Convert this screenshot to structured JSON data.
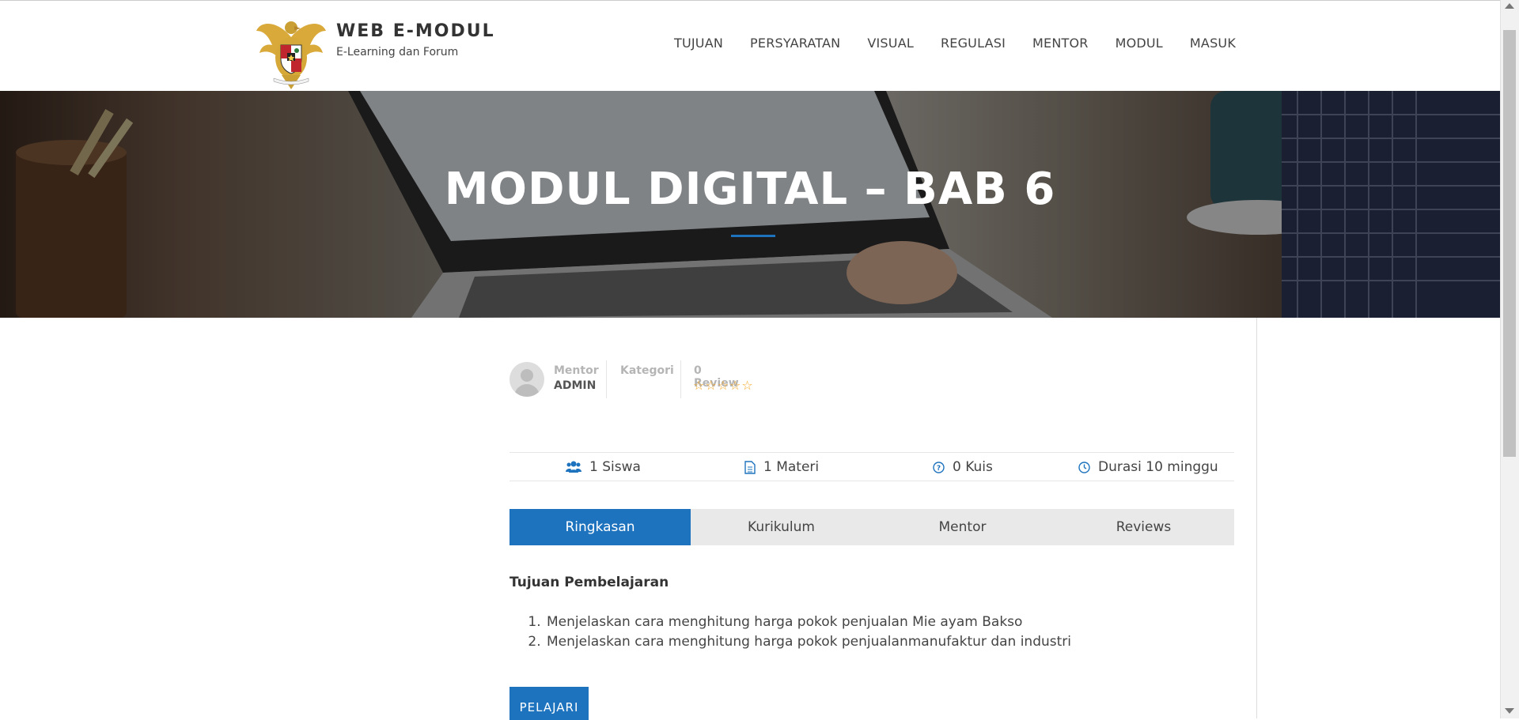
{
  "header": {
    "brand_title": "WEB E-MODUL",
    "brand_subtitle": "E-Learning dan Forum",
    "nav": [
      "TUJUAN",
      "PERSYARATAN",
      "VISUAL",
      "REGULASI",
      "MENTOR",
      "MODUL",
      "MASUK"
    ]
  },
  "hero": {
    "title": "MODUL DIGITAL – BAB 6"
  },
  "meta": {
    "mentor_label": "Mentor",
    "mentor_value": "ADMIN",
    "kategori_label": "Kategori",
    "review_label": "0 Review",
    "stars": "☆☆☆☆☆"
  },
  "stats": {
    "siswa": "1 Siswa",
    "materi": "1 Materi",
    "kuis": "0 Kuis",
    "durasi": "Durasi 10 minggu"
  },
  "tabs": [
    "Ringkasan",
    "Kurikulum",
    "Mentor",
    "Reviews"
  ],
  "content": {
    "section_title": "Tujuan Pembelajaran",
    "goals": [
      "Menjelaskan cara menghitung harga pokok penjualan Mie ayam Bakso",
      "Menjelaskan cara menghitung harga pokok penjualanmanufaktur dan industri"
    ],
    "button_label": "PELAJARI"
  },
  "colors": {
    "accent": "#1e73be",
    "star": "#f5a623"
  }
}
